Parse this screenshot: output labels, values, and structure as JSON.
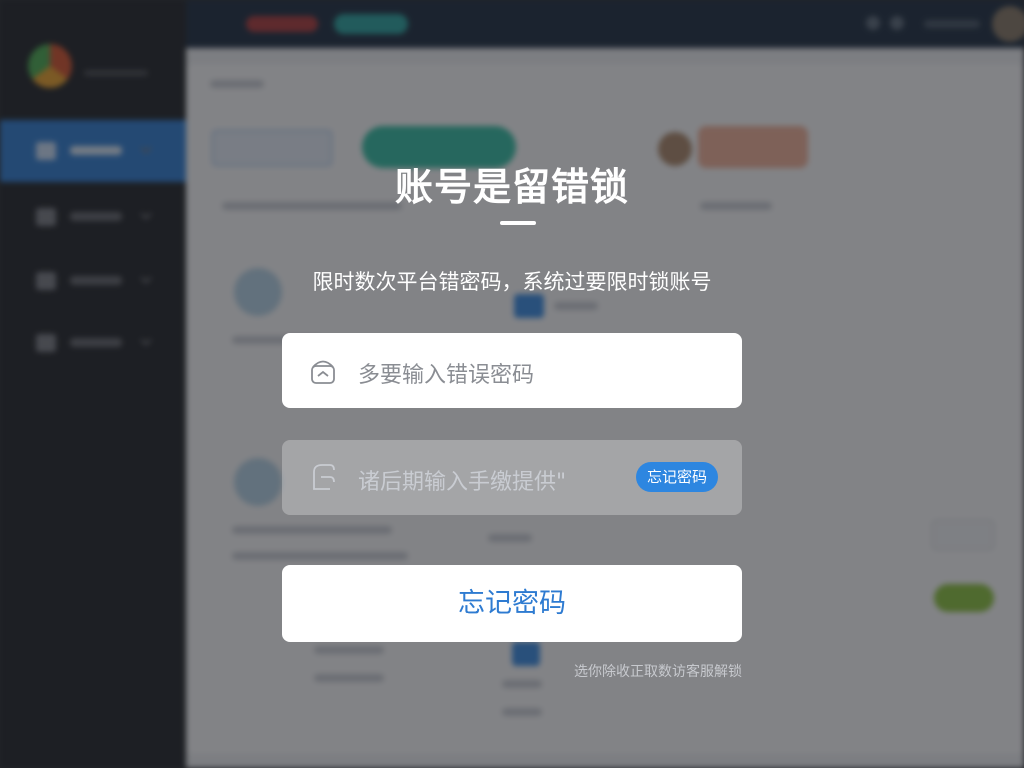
{
  "dialog": {
    "title": "账号是留错锁",
    "subtitle": "限时数次平台错密码，系统过要限时锁账号",
    "password_field": {
      "placeholder": "多要输入错误密码"
    },
    "second_field": {
      "placeholder": "诸后期输入手缴提供\"",
      "badge_label": "忘记密码"
    },
    "primary_button_label": "忘记密码",
    "footer_note": "选你除收正取数访客服解锁"
  },
  "background_app": {
    "sidebar_active_item_color": "#2f7fd6",
    "topbar_color": "#1c2c3f"
  }
}
